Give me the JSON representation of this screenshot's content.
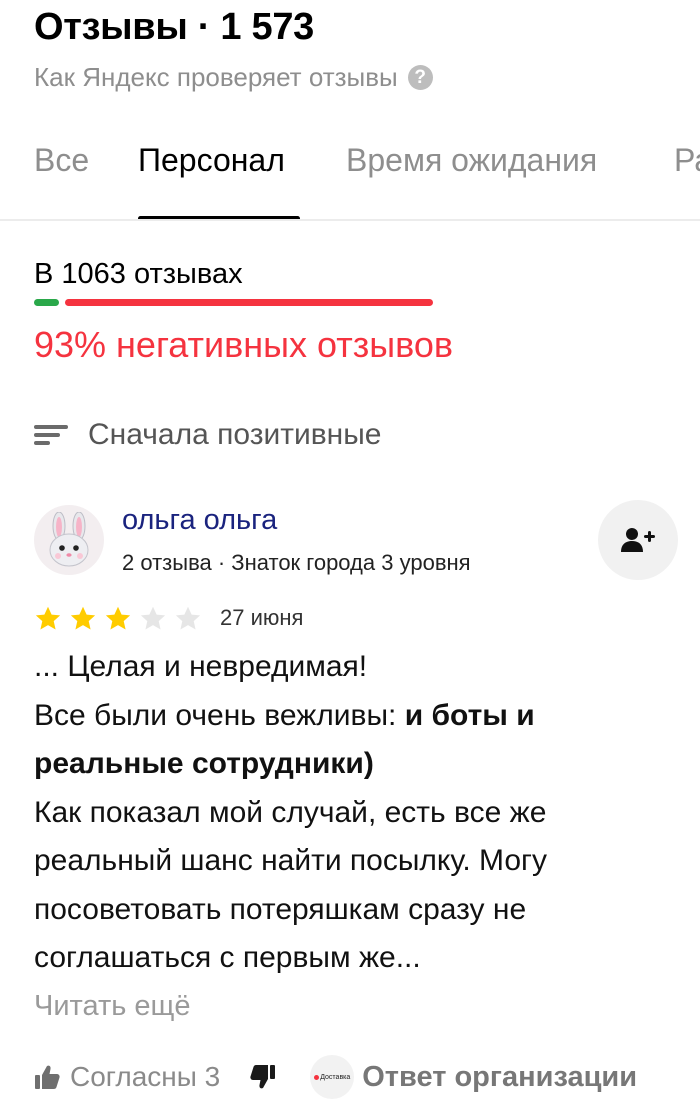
{
  "header": {
    "title": "Отзывы · 1 573",
    "subtitle": "Как Яндекс проверяет отзывы",
    "help_glyph": "?"
  },
  "tabs": [
    {
      "label": "Все",
      "active": false
    },
    {
      "label": "Персонал",
      "active": true
    },
    {
      "label": "Время ожидания",
      "active": false
    },
    {
      "label": "Ра",
      "active": false
    }
  ],
  "aspect_summary": {
    "count_text": "В 1063 отзывах",
    "negative_text": "93% негативных отзывов",
    "negative_share": 0.93,
    "colors": {
      "positive": "#2aa84a",
      "negative": "#f5333f"
    }
  },
  "sort": {
    "label": "Сначала позитивные",
    "icon": "sort-lines-icon"
  },
  "review": {
    "author": {
      "name": "ольга ольга",
      "meta": "2 отзыва · Знаток города 3 уровня",
      "avatar": "bunny-emoji-avatar",
      "avatar_glyph": "🐰"
    },
    "add_button_icon": "add-user-icon",
    "rating": 3,
    "rating_max": 5,
    "date": "27 июня",
    "text": {
      "line1": "... Целая и невредимая!",
      "line2_plain": "Все были очень вежливы: ",
      "line2_bold": "и боты и реальные сотрудники)",
      "rest": "Как показал мой случай, есть все же реальный шанс найти посылку. Могу посоветовать потеряшкам сразу не соглашаться с первым же..."
    },
    "read_more": "Читать ещё",
    "footer": {
      "like_label": "Согласны 3",
      "org_logo_text": "Доставка",
      "org_reply": "Ответ организации"
    }
  },
  "colors": {
    "accent_negative": "#f5333f",
    "author_link": "#1a237e",
    "star_filled": "#ffcc00",
    "star_empty": "#e6e6e6"
  }
}
